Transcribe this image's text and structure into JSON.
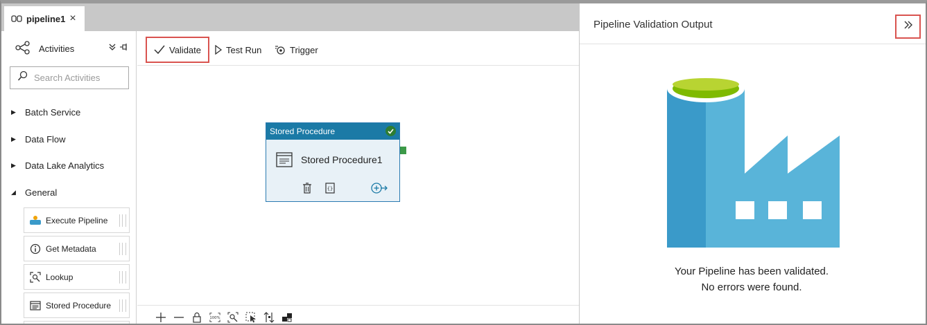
{
  "tab": {
    "label": "pipeline1",
    "close": "×"
  },
  "activities": {
    "header": "Activities",
    "search_placeholder": "Search Activities",
    "categories": [
      {
        "label": "Batch Service",
        "expanded": false
      },
      {
        "label": "Data Flow",
        "expanded": false
      },
      {
        "label": "Data Lake Analytics",
        "expanded": false
      },
      {
        "label": "General",
        "expanded": true
      }
    ],
    "items": [
      {
        "label": "Execute Pipeline",
        "icon": "execute-pipeline-icon"
      },
      {
        "label": "Get Metadata",
        "icon": "info-icon"
      },
      {
        "label": "Lookup",
        "icon": "lookup-icon"
      },
      {
        "label": "Stored Procedure",
        "icon": "stored-procedure-icon"
      }
    ]
  },
  "toolbar": {
    "validate": "Validate",
    "test_run": "Test Run",
    "trigger": "Trigger"
  },
  "node": {
    "type": "Stored Procedure",
    "name": "Stored Procedure1"
  },
  "zoom_controls": [
    "plus-icon",
    "minus-icon",
    "lock-icon",
    "zoom-100-icon",
    "zoom-fit-icon",
    "select-icon",
    "auto-align-icon",
    "layout-icon"
  ],
  "validation": {
    "title": "Pipeline Validation Output",
    "message_line1": "Your Pipeline has been validated.",
    "message_line2": "No errors were found."
  },
  "colors": {
    "accent": "#1b7aa6",
    "highlight_border": "#d9534f",
    "success": "#2e7d32",
    "factory_dark": "#3a9ac9",
    "factory_light": "#59b4d9",
    "factory_top": "#7fba00"
  }
}
